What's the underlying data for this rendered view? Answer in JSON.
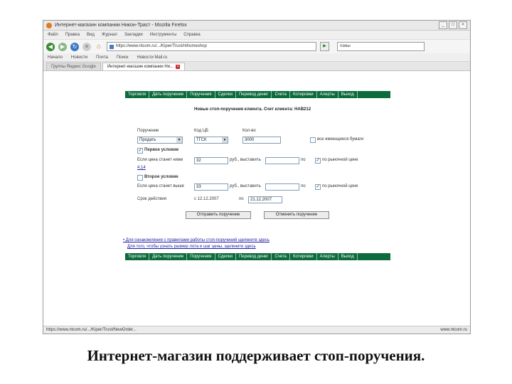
{
  "window": {
    "title": "Интернет-магазин компании Никон-Траст - Mozilla Firefox"
  },
  "menu": [
    "Файл",
    "Правка",
    "Вид",
    "Журнал",
    "Закладки",
    "Инструменты",
    "Справка"
  ],
  "nav": {
    "url": "https://www.ntcom.ru/.../Kiper/Trust/nthomeshop",
    "search": "пэмы"
  },
  "bookmarks": [
    "Начало",
    "Новости",
    "Почта",
    "Поиск",
    "Новости Mail.ru"
  ],
  "tabs": [
    {
      "label": "Группы Яндекс Google"
    },
    {
      "label": "Интернет-магазин компании Ни..."
    }
  ],
  "store_nav": [
    "Торговля",
    "Дать поручение",
    "Поручения",
    "Сделки",
    "Перевод денег",
    "Счета",
    "Котировки",
    "Алерты",
    "Выход"
  ],
  "form": {
    "title": "Новые стоп-поручения клиента. Счет клиента: НАВ212",
    "label_action": "Поручение",
    "label_code": "Код ЦБ",
    "label_qty": "Кол-во",
    "action_value": "Продать",
    "code_value": "ТГСК",
    "qty_value": "3000",
    "label_market": "все имеющиеся бумаги",
    "cond1_label": "Первое условие",
    "cond1_price_label": "Если цена станет ниже",
    "cond1_price": "32",
    "cond1_unit": "руб., выставить",
    "cond1_tail": "по",
    "cond1_market": "по рыночной цене",
    "cond1_link": "4.14",
    "cond2_label": "Второе условие",
    "cond2_price_label": "Если цена станет выше",
    "cond2_price": "33",
    "cond2_unit": "руб., выставить",
    "cond2_tail": "по",
    "cond2_market": "по рыночной цене",
    "period_label": "Срок действия",
    "period_from": "с 12.12.2007",
    "period_to_label": "по",
    "period_to": "21.12.2007",
    "btn_submit": "Отправить поручение",
    "btn_cancel": "Отменить поручение"
  },
  "help": {
    "line1": "• Для ознакомления с правилами работы стоп-поручений щелкните здесь",
    "line2": "Для того, чтобы узнать размер лота и шаг цены, щелкните здесь"
  },
  "status": {
    "left": "https://www.ntcom.ru/.../Kiper/Trust/NewOrder...",
    "right": "www.ntcom.ru"
  },
  "caption": "Интернет-магазин поддерживает стоп-поручения."
}
